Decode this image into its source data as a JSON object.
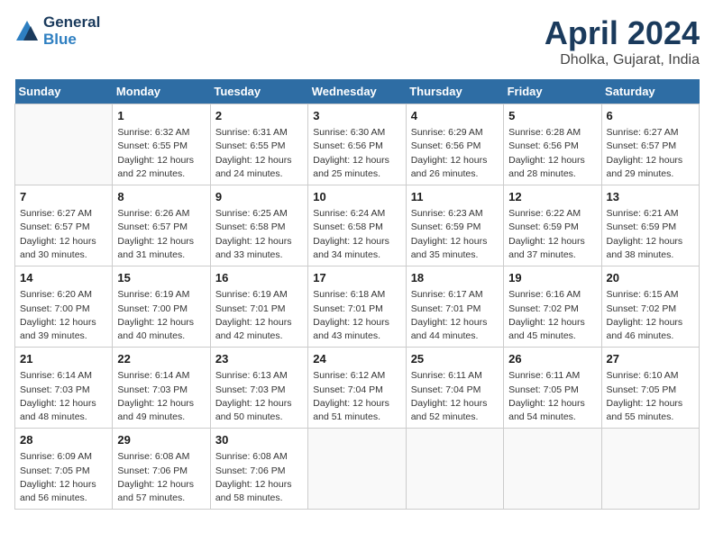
{
  "header": {
    "logo_line1": "General",
    "logo_line2": "Blue",
    "month": "April 2024",
    "location": "Dholka, Gujarat, India"
  },
  "days_of_week": [
    "Sunday",
    "Monday",
    "Tuesday",
    "Wednesday",
    "Thursday",
    "Friday",
    "Saturday"
  ],
  "weeks": [
    [
      {
        "day": "",
        "info": ""
      },
      {
        "day": "1",
        "info": "Sunrise: 6:32 AM\nSunset: 6:55 PM\nDaylight: 12 hours\nand 22 minutes."
      },
      {
        "day": "2",
        "info": "Sunrise: 6:31 AM\nSunset: 6:55 PM\nDaylight: 12 hours\nand 24 minutes."
      },
      {
        "day": "3",
        "info": "Sunrise: 6:30 AM\nSunset: 6:56 PM\nDaylight: 12 hours\nand 25 minutes."
      },
      {
        "day": "4",
        "info": "Sunrise: 6:29 AM\nSunset: 6:56 PM\nDaylight: 12 hours\nand 26 minutes."
      },
      {
        "day": "5",
        "info": "Sunrise: 6:28 AM\nSunset: 6:56 PM\nDaylight: 12 hours\nand 28 minutes."
      },
      {
        "day": "6",
        "info": "Sunrise: 6:27 AM\nSunset: 6:57 PM\nDaylight: 12 hours\nand 29 minutes."
      }
    ],
    [
      {
        "day": "7",
        "info": "Sunrise: 6:27 AM\nSunset: 6:57 PM\nDaylight: 12 hours\nand 30 minutes."
      },
      {
        "day": "8",
        "info": "Sunrise: 6:26 AM\nSunset: 6:57 PM\nDaylight: 12 hours\nand 31 minutes."
      },
      {
        "day": "9",
        "info": "Sunrise: 6:25 AM\nSunset: 6:58 PM\nDaylight: 12 hours\nand 33 minutes."
      },
      {
        "day": "10",
        "info": "Sunrise: 6:24 AM\nSunset: 6:58 PM\nDaylight: 12 hours\nand 34 minutes."
      },
      {
        "day": "11",
        "info": "Sunrise: 6:23 AM\nSunset: 6:59 PM\nDaylight: 12 hours\nand 35 minutes."
      },
      {
        "day": "12",
        "info": "Sunrise: 6:22 AM\nSunset: 6:59 PM\nDaylight: 12 hours\nand 37 minutes."
      },
      {
        "day": "13",
        "info": "Sunrise: 6:21 AM\nSunset: 6:59 PM\nDaylight: 12 hours\nand 38 minutes."
      }
    ],
    [
      {
        "day": "14",
        "info": "Sunrise: 6:20 AM\nSunset: 7:00 PM\nDaylight: 12 hours\nand 39 minutes."
      },
      {
        "day": "15",
        "info": "Sunrise: 6:19 AM\nSunset: 7:00 PM\nDaylight: 12 hours\nand 40 minutes."
      },
      {
        "day": "16",
        "info": "Sunrise: 6:19 AM\nSunset: 7:01 PM\nDaylight: 12 hours\nand 42 minutes."
      },
      {
        "day": "17",
        "info": "Sunrise: 6:18 AM\nSunset: 7:01 PM\nDaylight: 12 hours\nand 43 minutes."
      },
      {
        "day": "18",
        "info": "Sunrise: 6:17 AM\nSunset: 7:01 PM\nDaylight: 12 hours\nand 44 minutes."
      },
      {
        "day": "19",
        "info": "Sunrise: 6:16 AM\nSunset: 7:02 PM\nDaylight: 12 hours\nand 45 minutes."
      },
      {
        "day": "20",
        "info": "Sunrise: 6:15 AM\nSunset: 7:02 PM\nDaylight: 12 hours\nand 46 minutes."
      }
    ],
    [
      {
        "day": "21",
        "info": "Sunrise: 6:14 AM\nSunset: 7:03 PM\nDaylight: 12 hours\nand 48 minutes."
      },
      {
        "day": "22",
        "info": "Sunrise: 6:14 AM\nSunset: 7:03 PM\nDaylight: 12 hours\nand 49 minutes."
      },
      {
        "day": "23",
        "info": "Sunrise: 6:13 AM\nSunset: 7:03 PM\nDaylight: 12 hours\nand 50 minutes."
      },
      {
        "day": "24",
        "info": "Sunrise: 6:12 AM\nSunset: 7:04 PM\nDaylight: 12 hours\nand 51 minutes."
      },
      {
        "day": "25",
        "info": "Sunrise: 6:11 AM\nSunset: 7:04 PM\nDaylight: 12 hours\nand 52 minutes."
      },
      {
        "day": "26",
        "info": "Sunrise: 6:11 AM\nSunset: 7:05 PM\nDaylight: 12 hours\nand 54 minutes."
      },
      {
        "day": "27",
        "info": "Sunrise: 6:10 AM\nSunset: 7:05 PM\nDaylight: 12 hours\nand 55 minutes."
      }
    ],
    [
      {
        "day": "28",
        "info": "Sunrise: 6:09 AM\nSunset: 7:05 PM\nDaylight: 12 hours\nand 56 minutes."
      },
      {
        "day": "29",
        "info": "Sunrise: 6:08 AM\nSunset: 7:06 PM\nDaylight: 12 hours\nand 57 minutes."
      },
      {
        "day": "30",
        "info": "Sunrise: 6:08 AM\nSunset: 7:06 PM\nDaylight: 12 hours\nand 58 minutes."
      },
      {
        "day": "",
        "info": ""
      },
      {
        "day": "",
        "info": ""
      },
      {
        "day": "",
        "info": ""
      },
      {
        "day": "",
        "info": ""
      }
    ]
  ]
}
